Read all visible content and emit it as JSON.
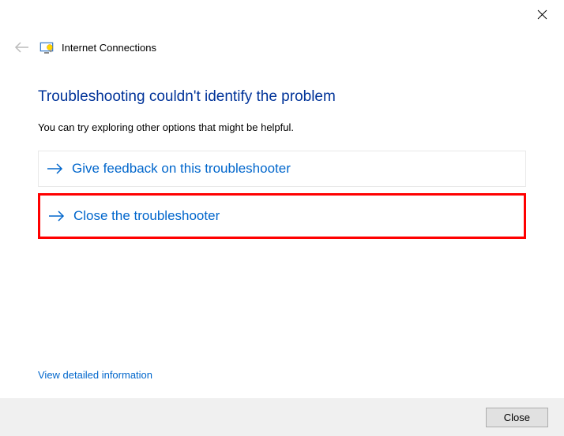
{
  "window": {
    "title": "Internet Connections"
  },
  "main": {
    "heading": "Troubleshooting couldn't identify the problem",
    "subtext": "You can try exploring other options that might be helpful.",
    "options": {
      "feedback": "Give feedback on this troubleshooter",
      "close": "Close the troubleshooter"
    },
    "detailed_link": "View detailed information"
  },
  "footer": {
    "close_label": "Close"
  }
}
